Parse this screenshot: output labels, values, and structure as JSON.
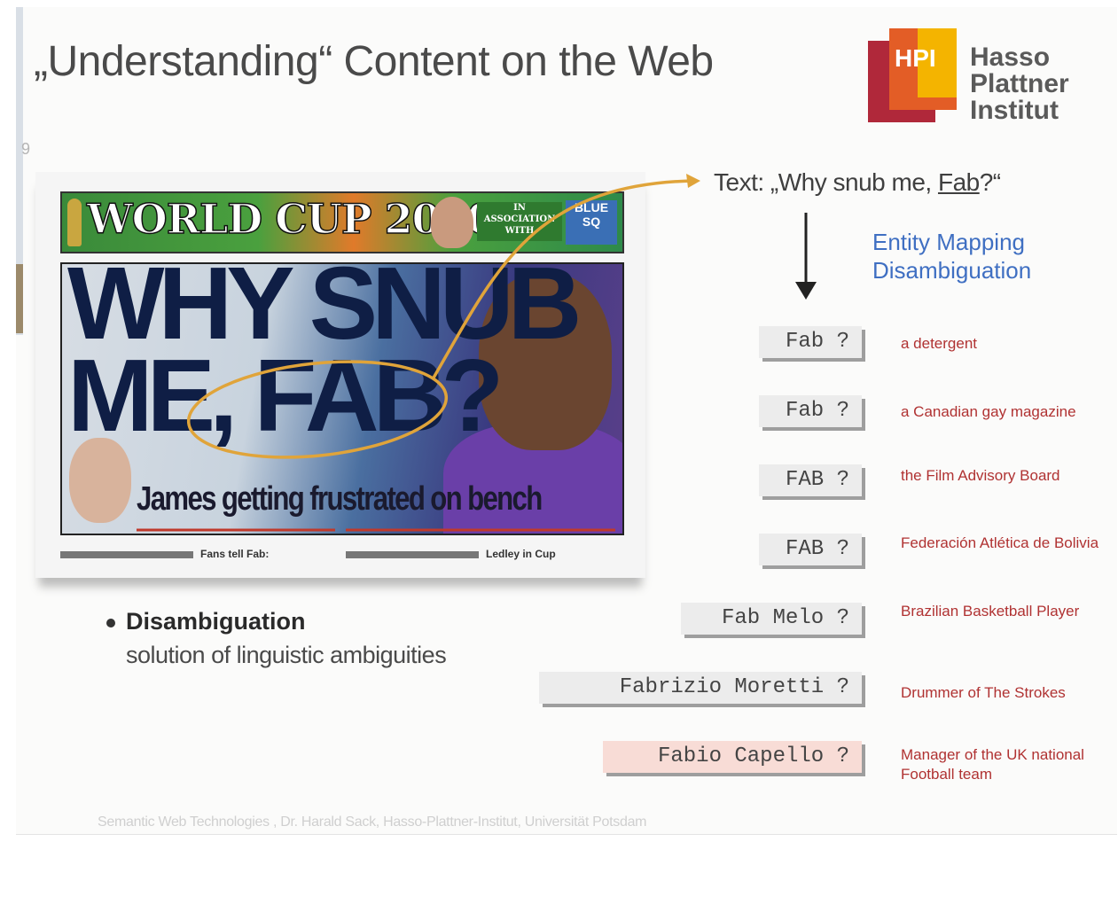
{
  "slide": {
    "title": "„Understanding“ Content on the Web",
    "page_number": "9",
    "logo": {
      "abbr": "HPI",
      "line1": "Hasso",
      "line2": "Plattner",
      "line3": "Institut"
    },
    "newspaper": {
      "banner": "WORLD CUP 2010",
      "association": [
        "IN",
        "ASSOCIATION",
        "WITH"
      ],
      "badge": [
        "BLUE",
        "SQ"
      ],
      "headline_line1": "WHY SNUB",
      "headline_line2": "ME, FAB?",
      "caption": "James getting frustrated on bench",
      "teaser1": "Fans tell Fab:",
      "teaser2": "Ledley in Cup"
    },
    "sentence_prefix": "Text: „Why snub me, ",
    "sentence_entity": "Fab",
    "sentence_suffix": "?“",
    "process_label_line1": "Entity Mapping",
    "process_label_line2": "Disambiguation",
    "candidates": [
      {
        "label": "Fab  ?",
        "meaning": "a detergent"
      },
      {
        "label": "Fab  ?",
        "meaning": "a Canadian gay magazine"
      },
      {
        "label": "FAB  ?",
        "meaning": "the Film Advisory Board"
      },
      {
        "label": "FAB  ?",
        "meaning": "Federación Atlética de Bolivia"
      },
      {
        "label": "Fab Melo  ?",
        "meaning": "Brazilian Basketball Player"
      },
      {
        "label": "Fabrizio Moretti  ?",
        "meaning": "Drummer of The Strokes"
      },
      {
        "label": "Fabio Capello  ?",
        "meaning": "Manager of the UK national Football team",
        "highlighted": true
      }
    ],
    "bullet_heading": "Disambiguation",
    "bullet_text": "solution of linguistic ambiguities",
    "footer": "Semantic Web Technologies , Dr. Harald Sack, Hasso-Plattner-Institut, Universität Potsdam",
    "colors": {
      "accent_blue": "#3f6fc2",
      "definition_red": "#b03232",
      "highlight": "#f8dcd6",
      "arrow_orange": "#e0a43a"
    }
  }
}
